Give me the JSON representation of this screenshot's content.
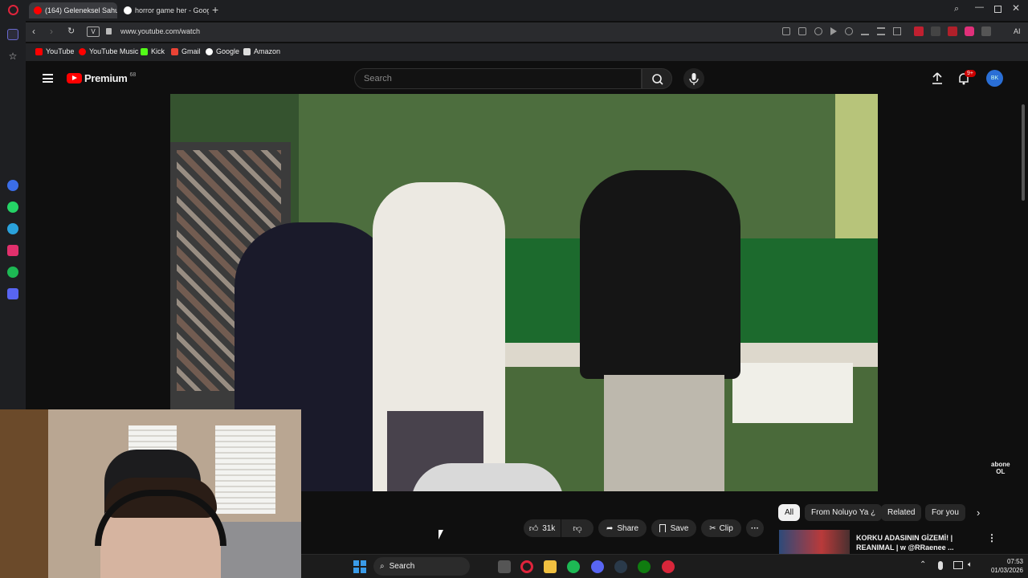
{
  "browser": {
    "tabs": [
      {
        "label": "(164) Geleneksel Sahu"
      },
      {
        "label": "horror game her - Google"
      }
    ],
    "new_tab": "+",
    "url": "www.youtube.com/watch",
    "url_badge": "V",
    "ai_label": "AI",
    "bookmarks": [
      "YouTube",
      "YouTube Music",
      "Kick",
      "Gmail",
      "Google",
      "Amazon"
    ]
  },
  "youtube": {
    "logo": "Premium",
    "logo_sup": "68",
    "search_placeholder": "Search",
    "notification_count": "9+",
    "avatar_text": "BK",
    "watermark_line1": "abone",
    "watermark_line2": "OL",
    "actions": {
      "likes": "31k",
      "share": "Share",
      "save": "Save",
      "clip": "Clip",
      "more": "···"
    },
    "chips": [
      "All",
      "From Noluyo Ya ¿",
      "Related",
      "For you"
    ],
    "recommended": {
      "title_line1": "KORKU ADASININ GİZEMİ! |",
      "title_line2": "REANIMAL | w @RRaenee ..."
    }
  },
  "taskbar": {
    "search_label": "Search",
    "time": "07:53",
    "date": "01/03/2026"
  },
  "colors": {
    "accent_red": "#ff0000",
    "youtube_bg": "#0f0f0f",
    "cabinet_green": "#4d6e3e"
  }
}
